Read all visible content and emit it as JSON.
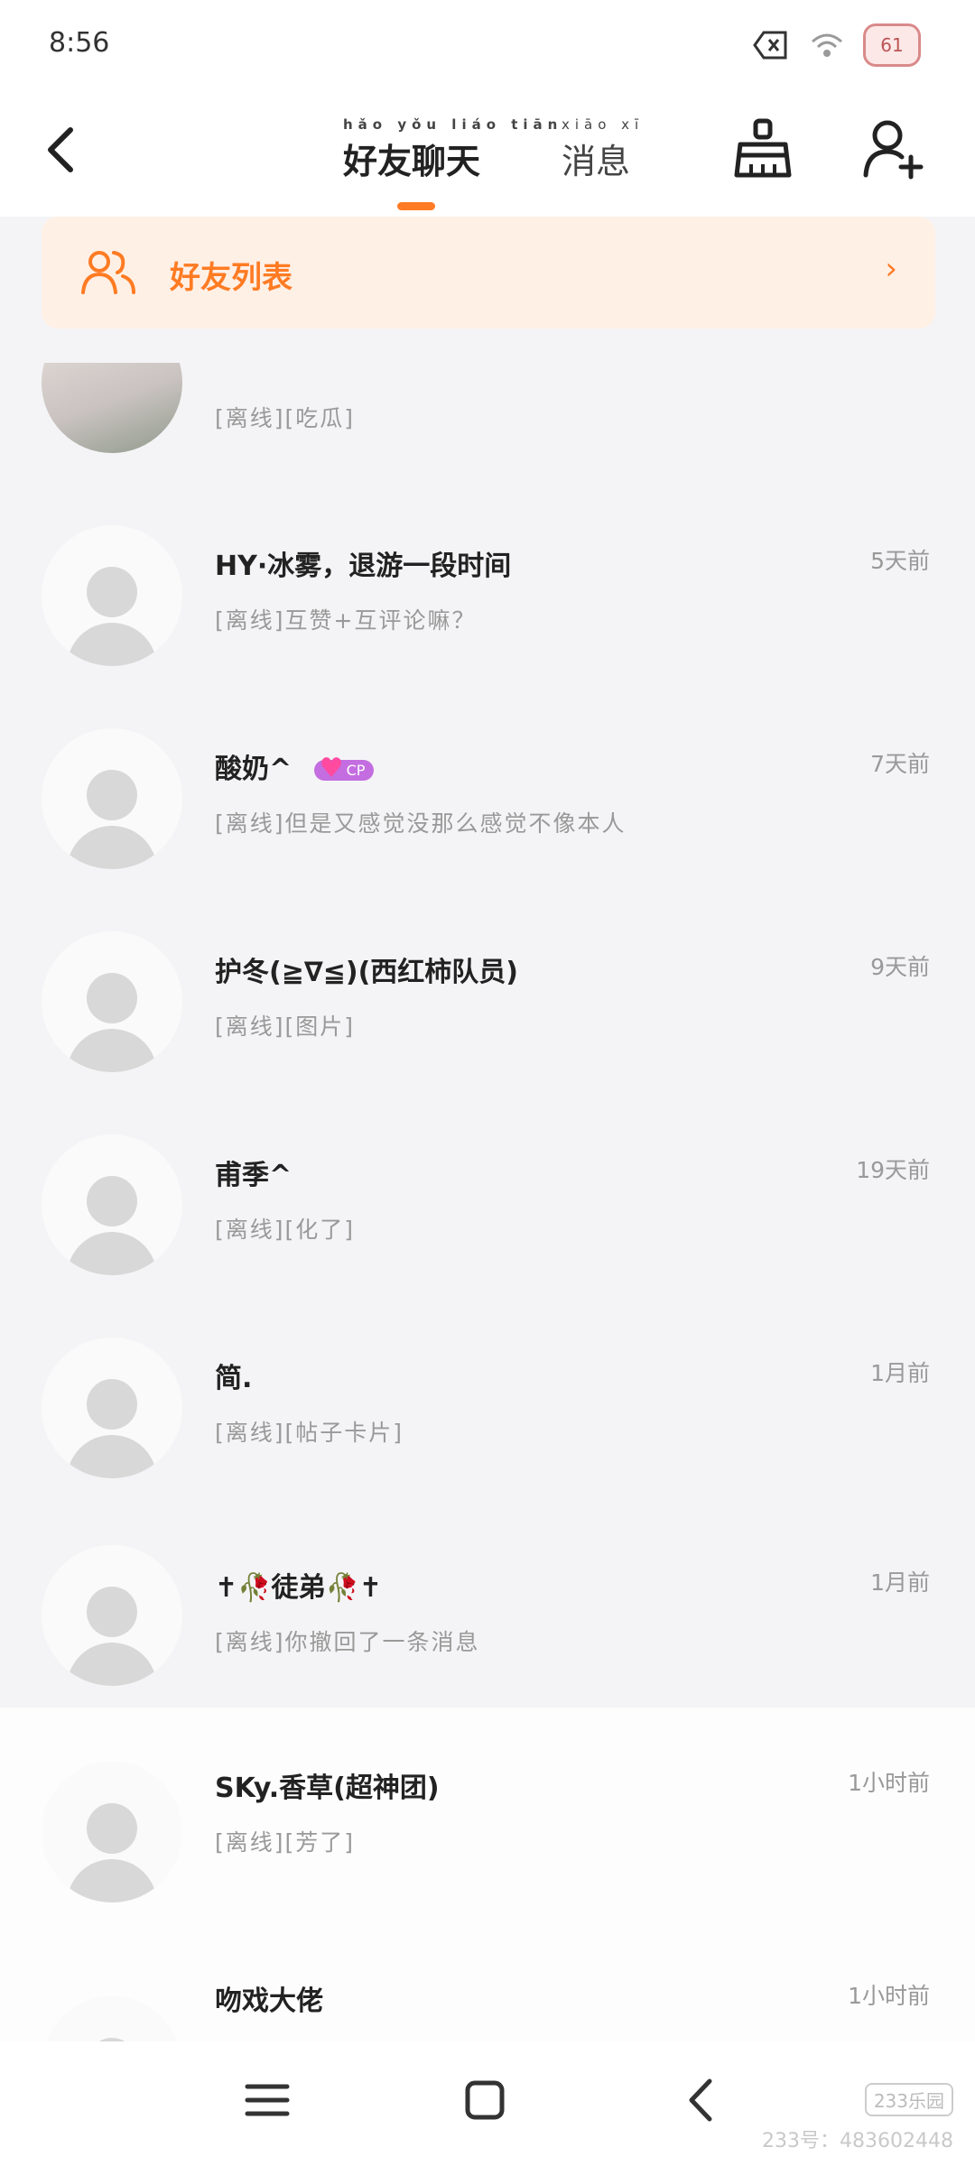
{
  "status": {
    "time": "8:56",
    "battery": "61"
  },
  "header": {
    "tabs": [
      {
        "label": "好友聊天",
        "pinyin": "hǎo yǒu liáo tiān",
        "active": true
      },
      {
        "label": "消息",
        "pinyin": "xiāo xī",
        "active": false
      }
    ]
  },
  "friends_banner": {
    "label": "好友列表"
  },
  "conversations": [
    {
      "name": "",
      "message": "[离线][吃瓜]",
      "time": "",
      "avatar": "photo"
    },
    {
      "name": "HY·冰雾，退游一段时间",
      "message": "[离线]互赞+互评论嘛？",
      "time": "5天前",
      "avatar": "default"
    },
    {
      "name": "酸奶^",
      "message": "[离线]但是又感觉没那么感觉不像本人",
      "time": "7天前",
      "avatar": "default",
      "badge": "CP"
    },
    {
      "name": "护冬(≧∇≦)(西红柿队员)",
      "message": "[离线][图片]",
      "time": "9天前",
      "avatar": "default"
    },
    {
      "name": "甫季^",
      "message": "[离线][化了]",
      "time": "19天前",
      "avatar": "default"
    },
    {
      "name": "简.",
      "message": "[离线][帖子卡片]",
      "time": "1月前",
      "avatar": "default"
    },
    {
      "name": "✝🥀徒弟🥀✝",
      "message": "[离线]你撤回了一条消息",
      "time": "1月前",
      "avatar": "default"
    },
    {
      "name": "SKy.香草(超神团)",
      "message": "[离线][芳了]",
      "time": "1小时前",
      "avatar": "default"
    },
    {
      "name": "吻戏大佬",
      "message": "",
      "time": "1小时前",
      "avatar": "default"
    }
  ],
  "watermark": {
    "logo": "233乐园",
    "id": "233号：483602448"
  }
}
